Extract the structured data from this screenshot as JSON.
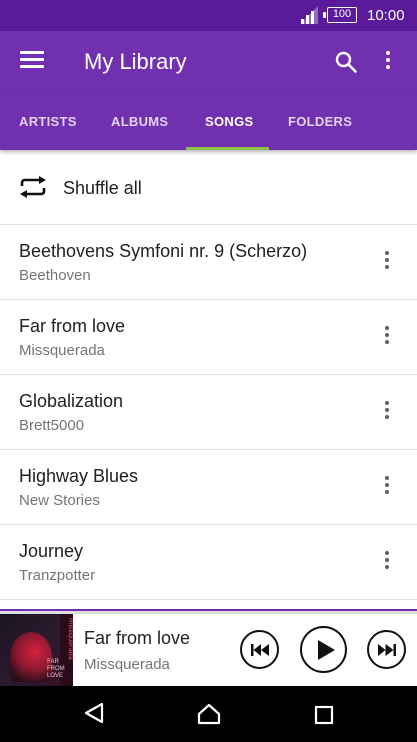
{
  "status_bar": {
    "battery": "100",
    "time": "10:00"
  },
  "app_bar": {
    "title": "My Library"
  },
  "tabs": [
    {
      "label": "ARTISTS",
      "active": false
    },
    {
      "label": "ALBUMS",
      "active": false
    },
    {
      "label": "SONGS",
      "active": true
    },
    {
      "label": "FOLDERS",
      "active": false
    }
  ],
  "shuffle": {
    "label": "Shuffle all"
  },
  "songs": [
    {
      "title": "Beethovens Symfoni nr. 9 (Scherzo)",
      "artist": "Beethoven"
    },
    {
      "title": "Far from love",
      "artist": "Missquerada"
    },
    {
      "title": "Globalization",
      "artist": "Brett5000"
    },
    {
      "title": "Highway Blues",
      "artist": "New Stories"
    },
    {
      "title": "Journey",
      "artist": "Tranzpotter"
    }
  ],
  "now_playing": {
    "title": "Far from love",
    "artist": "Missquerada",
    "art_text": "missquerada",
    "art_caption": "FAR FROM LOVE"
  },
  "colors": {
    "status_bar": "#5a1a9a",
    "app_bar": "#7030b0",
    "tab_indicator": "#8bc34a"
  },
  "icons": {
    "menu": "hamburger-icon",
    "search": "search-icon",
    "overflow": "more-vert-icon",
    "shuffle": "shuffle-repeat-icon",
    "previous": "skip-previous-icon",
    "play": "play-icon",
    "next": "skip-next-icon",
    "back": "back-triangle-icon",
    "home": "home-icon",
    "recents": "recents-square-icon"
  }
}
